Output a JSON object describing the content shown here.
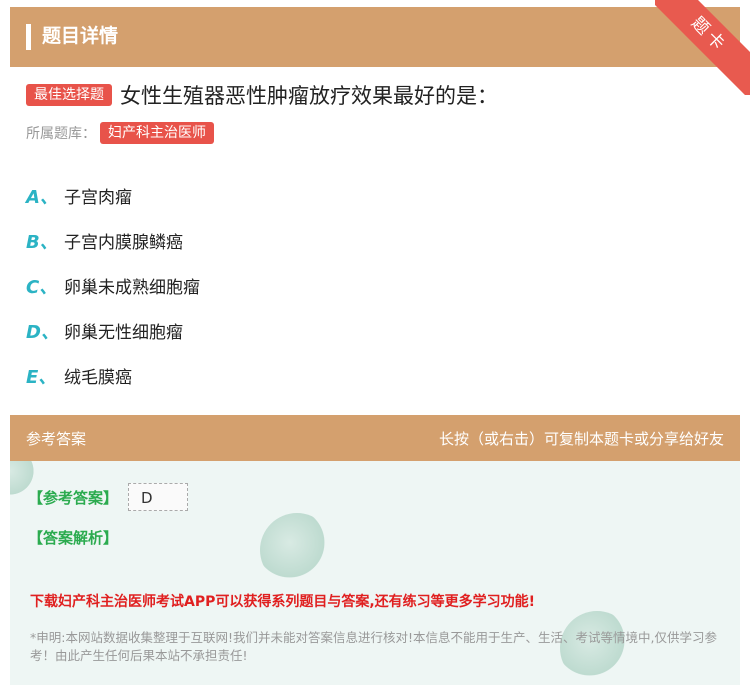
{
  "header": {
    "title": "题目详情",
    "corner_label": "题卡"
  },
  "question": {
    "type_badge": "最佳选择题",
    "text": "女性生殖器恶性肿瘤放疗效果最好的是：",
    "library_label": "所属题库：",
    "library_name": "妇产科主治医师"
  },
  "options": [
    {
      "letter": "A、",
      "text": "子宫肉瘤"
    },
    {
      "letter": "B、",
      "text": "子宫内膜腺鳞癌"
    },
    {
      "letter": "C、",
      "text": "卵巢未成熟细胞瘤"
    },
    {
      "letter": "D、",
      "text": "卵巢无性细胞瘤"
    },
    {
      "letter": "E、",
      "text": "绒毛膜癌"
    }
  ],
  "answer": {
    "section_title": "参考答案",
    "hint": "长按（或右击）可复制本题卡或分享给好友",
    "ref_label": "【参考答案】",
    "ref_value": "D",
    "analysis_label": "【答案解析】",
    "promo": "下载妇产科主治医师考试APP可以获得系列题目与答案,还有练习等更多学习功能!",
    "disclaimer": "*申明:本网站数据收集整理于互联网!我们并未能对答案信息进行核对!本信息不能用于生产、生活、考试等情境中,仅供学习参考！由此产生任何后果本站不承担责任!"
  },
  "colors": {
    "header_bg": "#d4a06e",
    "badge_red": "#e8534a",
    "option_letter": "#2bb3c4",
    "answer_green": "#2bab4f",
    "promo_red": "#e02020"
  }
}
